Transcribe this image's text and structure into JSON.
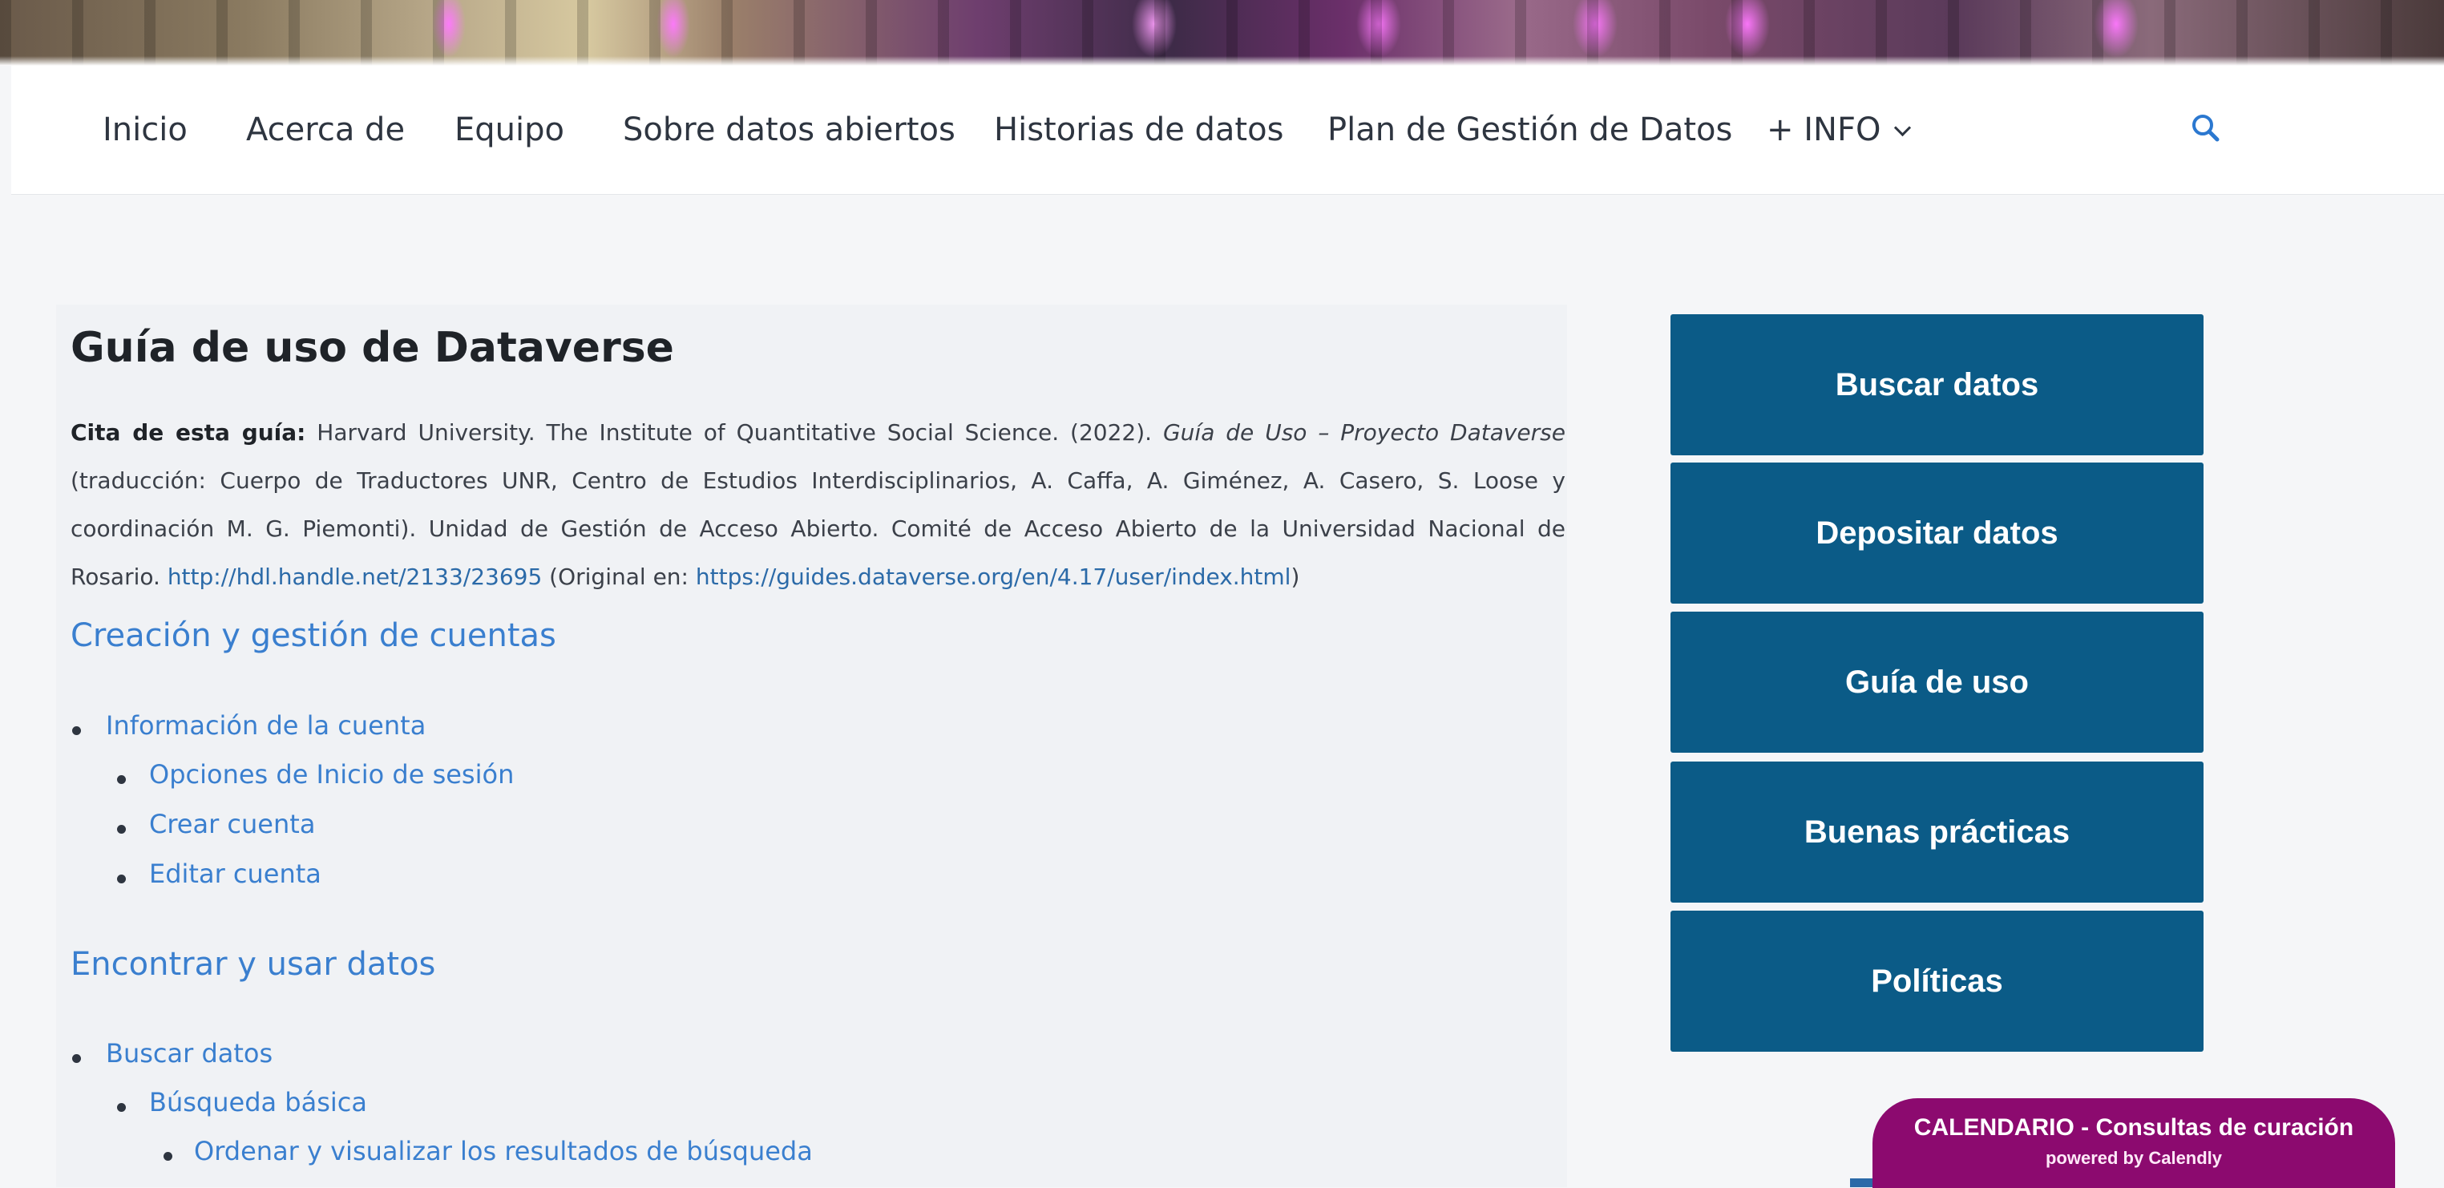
{
  "nav": {
    "items": [
      "Inicio",
      "Acerca de",
      "Equipo",
      "Sobre datos abiertos",
      "Historias de datos",
      "Plan de Gestión de Datos",
      "+ INFO"
    ]
  },
  "icons": {
    "search": "search-icon",
    "dropdown": "chevron-down-icon"
  },
  "colors": {
    "sidebar_button": "#0b5b87",
    "link": "#3a7fcf",
    "calendly": "#8c0a6f"
  },
  "main": {
    "title": "Guía de uso de Dataverse",
    "citation": {
      "label": "Cita de esta guía:",
      "text1": " Harvard University. The Institute of Quantitative Social Science. (2022). ",
      "title_italic": "Guía de Uso – Proyecto Dataverse",
      "text2": " (traducción: Cuerpo de Traductores UNR, Centro de Estudios Interdisciplinarios, A. Caffa, A. Giménez, A. Casero, S. Loose y coordinación M. G. Piemonti). Unidad de Gestión de Acceso Abierto. Comité de Acceso Abierto de la Universidad Nacional de Rosario. ",
      "link1": "http://hdl.handle.net/2133/23695",
      "text3": " (Original en: ",
      "link2": "https://guides.dataverse.org/en/4.17/user/index.html",
      "text4": ")"
    },
    "sections": [
      {
        "heading": "Creación y gestión de cuentas",
        "items": [
          {
            "label": "Información de la cuenta"
          },
          {
            "label": "Opciones de Inicio de sesión"
          },
          {
            "label": "Crear cuenta"
          },
          {
            "label": "Editar cuenta"
          }
        ]
      },
      {
        "heading": "Encontrar y usar datos",
        "items": [
          {
            "label": "Buscar datos"
          },
          {
            "label": "Búsqueda básica"
          },
          {
            "label": "Ordenar y visualizar los resultados de búsqueda"
          }
        ]
      }
    ]
  },
  "sidebar": {
    "buttons": [
      "Buscar datos",
      "Depositar datos",
      "Guía de uso",
      "Buenas prácticas",
      "Políticas"
    ]
  },
  "calendly": {
    "title": "CALENDARIO - Consultas de curación",
    "subtitle": "powered by Calendly"
  }
}
